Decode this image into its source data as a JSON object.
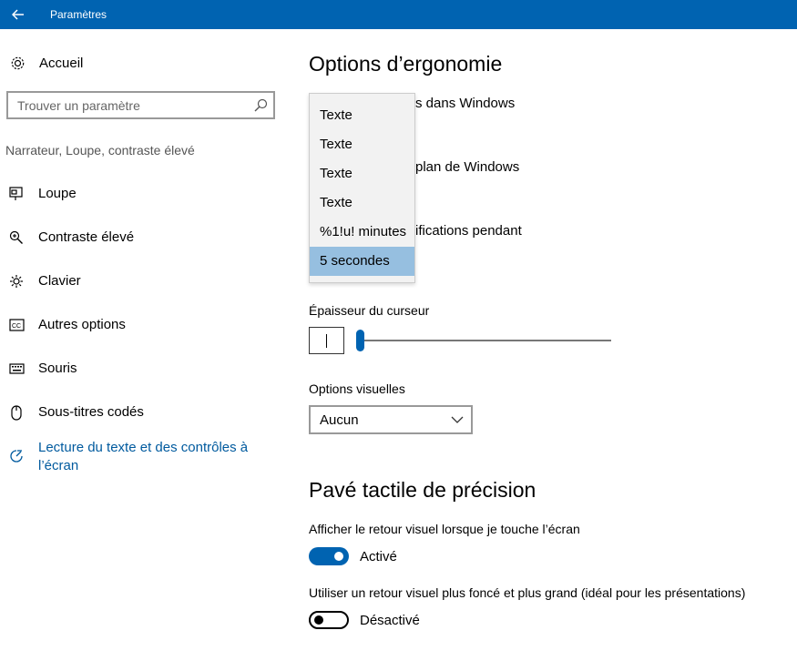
{
  "window": {
    "title": "Paramètres"
  },
  "sidebar": {
    "home_label": "Accueil",
    "search_placeholder": "Trouver un paramètre",
    "group_label": "Narrateur, Loupe, contraste élevé",
    "items": [
      {
        "label": "Loupe",
        "icon": "magnifier-screen-icon"
      },
      {
        "label": "Contraste élevé",
        "icon": "zoom-icon"
      },
      {
        "label": "Clavier",
        "icon": "sun-icon"
      },
      {
        "label": "Autres options",
        "icon": "closed-caption-icon"
      },
      {
        "label": "Souris",
        "icon": "keyboard-icon"
      },
      {
        "label": "Sous-titres codés",
        "icon": "mouse-icon"
      },
      {
        "label": "Lecture du texte et des contrôles à l’écran",
        "icon": "narrator-icon"
      }
    ]
  },
  "main": {
    "section1_title": "Options d’ergonomie",
    "partial_texts": [
      "s dans Windows",
      "plan de Windows",
      "ifications pendant"
    ],
    "dropdown_options": [
      "Texte",
      "Texte",
      "Texte",
      "Texte",
      "%1!u! minutes",
      "5 secondes"
    ],
    "dropdown_selected": "5 secondes",
    "cursor_thickness_label": "Épaisseur du curseur",
    "cursor_thickness_value": 1,
    "visual_options_label": "Options visuelles",
    "visual_options_value": "Aucun",
    "section2_title": "Pavé tactile de précision",
    "toggle1_label": "Afficher le retour visuel lorsque je touche l’écran",
    "toggle1_state": "Activé",
    "toggle2_label": "Utiliser un retour visuel plus foncé et plus grand (idéal pour les présentations)",
    "toggle2_state": "Désactivé"
  },
  "colors": {
    "accent": "#0063b1",
    "link": "#005a9e",
    "selected_option": "#96bfe0"
  }
}
